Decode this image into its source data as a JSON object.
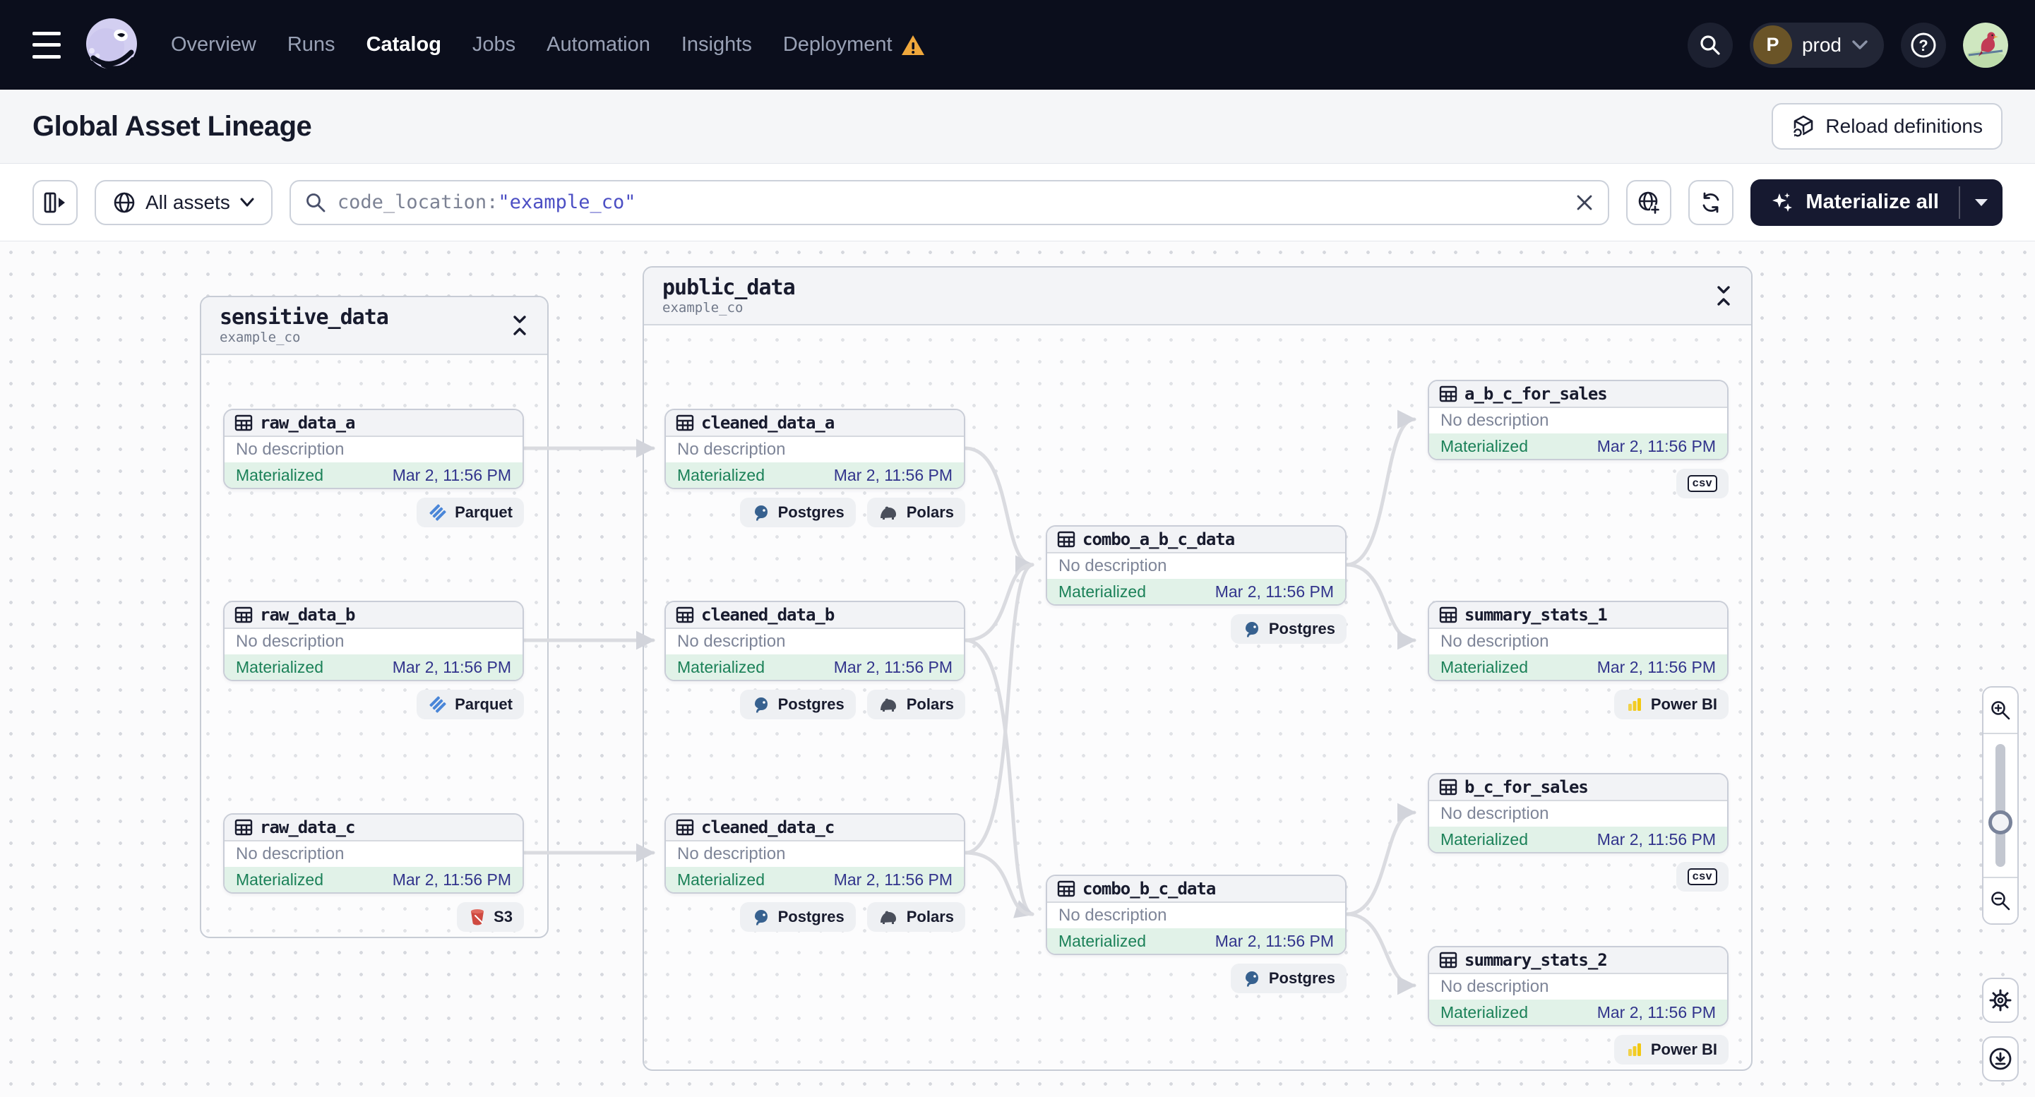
{
  "nav": {
    "items": [
      {
        "label": "Overview",
        "active": false
      },
      {
        "label": "Runs",
        "active": false
      },
      {
        "label": "Catalog",
        "active": true
      },
      {
        "label": "Jobs",
        "active": false
      },
      {
        "label": "Automation",
        "active": false
      },
      {
        "label": "Insights",
        "active": false
      },
      {
        "label": "Deployment",
        "active": false,
        "warning": true
      }
    ],
    "environment": {
      "initial": "P",
      "label": "prod"
    }
  },
  "header": {
    "title": "Global Asset Lineage",
    "reload_button": "Reload definitions"
  },
  "toolbar": {
    "scope_button": "All assets",
    "search_prefix": "code_location:",
    "search_term": "\"example_co\"",
    "materialize_button": "Materialize all"
  },
  "canvas": {
    "groups": [
      {
        "name": "sensitive_data",
        "location": "example_co"
      },
      {
        "name": "public_data",
        "location": "example_co"
      }
    ],
    "nodes": [
      {
        "name": "raw_data_a",
        "description": "No description",
        "status": "Materialized",
        "timestamp": "Mar 2, 11:56 PM",
        "badges": [
          {
            "label": "Parquet",
            "icon": "parquet-icon"
          }
        ]
      },
      {
        "name": "raw_data_b",
        "description": "No description",
        "status": "Materialized",
        "timestamp": "Mar 2, 11:56 PM",
        "badges": [
          {
            "label": "Parquet",
            "icon": "parquet-icon"
          }
        ]
      },
      {
        "name": "raw_data_c",
        "description": "No description",
        "status": "Materialized",
        "timestamp": "Mar 2, 11:56 PM",
        "badges": [
          {
            "label": "S3",
            "icon": "s3-icon"
          }
        ]
      },
      {
        "name": "cleaned_data_a",
        "description": "No description",
        "status": "Materialized",
        "timestamp": "Mar 2, 11:56 PM",
        "badges": [
          {
            "label": "Postgres",
            "icon": "postgres-icon"
          },
          {
            "label": "Polars",
            "icon": "polars-icon"
          }
        ]
      },
      {
        "name": "cleaned_data_b",
        "description": "No description",
        "status": "Materialized",
        "timestamp": "Mar 2, 11:56 PM",
        "badges": [
          {
            "label": "Postgres",
            "icon": "postgres-icon"
          },
          {
            "label": "Polars",
            "icon": "polars-icon"
          }
        ]
      },
      {
        "name": "cleaned_data_c",
        "description": "No description",
        "status": "Materialized",
        "timestamp": "Mar 2, 11:56 PM",
        "badges": [
          {
            "label": "Postgres",
            "icon": "postgres-icon"
          },
          {
            "label": "Polars",
            "icon": "polars-icon"
          }
        ]
      },
      {
        "name": "combo_a_b_c_data",
        "description": "No description",
        "status": "Materialized",
        "timestamp": "Mar 2, 11:56 PM",
        "badges": [
          {
            "label": "Postgres",
            "icon": "postgres-icon"
          }
        ]
      },
      {
        "name": "combo_b_c_data",
        "description": "No description",
        "status": "Materialized",
        "timestamp": "Mar 2, 11:56 PM",
        "badges": [
          {
            "label": "Postgres",
            "icon": "postgres-icon"
          }
        ]
      },
      {
        "name": "a_b_c_for_sales",
        "description": "No description",
        "status": "Materialized",
        "timestamp": "Mar 2, 11:56 PM",
        "badges": [
          {
            "label": "csv",
            "icon": "csv-icon"
          }
        ]
      },
      {
        "name": "summary_stats_1",
        "description": "No description",
        "status": "Materialized",
        "timestamp": "Mar 2, 11:56 PM",
        "badges": [
          {
            "label": "Power BI",
            "icon": "powerbi-icon"
          }
        ]
      },
      {
        "name": "b_c_for_sales",
        "description": "No description",
        "status": "Materialized",
        "timestamp": "Mar 2, 11:56 PM",
        "badges": [
          {
            "label": "csv",
            "icon": "csv-icon"
          }
        ]
      },
      {
        "name": "summary_stats_2",
        "description": "No description",
        "status": "Materialized",
        "timestamp": "Mar 2, 11:56 PM",
        "badges": [
          {
            "label": "Power BI",
            "icon": "powerbi-icon"
          }
        ]
      }
    ],
    "edges": [
      {
        "from": "raw_data_a",
        "to": "cleaned_data_a"
      },
      {
        "from": "raw_data_b",
        "to": "cleaned_data_b"
      },
      {
        "from": "raw_data_c",
        "to": "cleaned_data_c"
      },
      {
        "from": "cleaned_data_a",
        "to": "combo_a_b_c_data"
      },
      {
        "from": "cleaned_data_b",
        "to": "combo_a_b_c_data"
      },
      {
        "from": "cleaned_data_c",
        "to": "combo_a_b_c_data"
      },
      {
        "from": "cleaned_data_b",
        "to": "combo_b_c_data"
      },
      {
        "from": "cleaned_data_c",
        "to": "combo_b_c_data"
      },
      {
        "from": "combo_a_b_c_data",
        "to": "a_b_c_for_sales"
      },
      {
        "from": "combo_a_b_c_data",
        "to": "summary_stats_1"
      },
      {
        "from": "combo_b_c_data",
        "to": "b_c_for_sales"
      },
      {
        "from": "combo_b_c_data",
        "to": "summary_stats_2"
      }
    ]
  },
  "colors": {
    "nav_bg": "#0b0e1c",
    "status_green": "#1b8158",
    "timestamp_indigo": "#32348c",
    "search_term_indigo": "#4c4fc4",
    "warning_amber": "#f0a83c",
    "edge_gray": "#dadbe0"
  }
}
